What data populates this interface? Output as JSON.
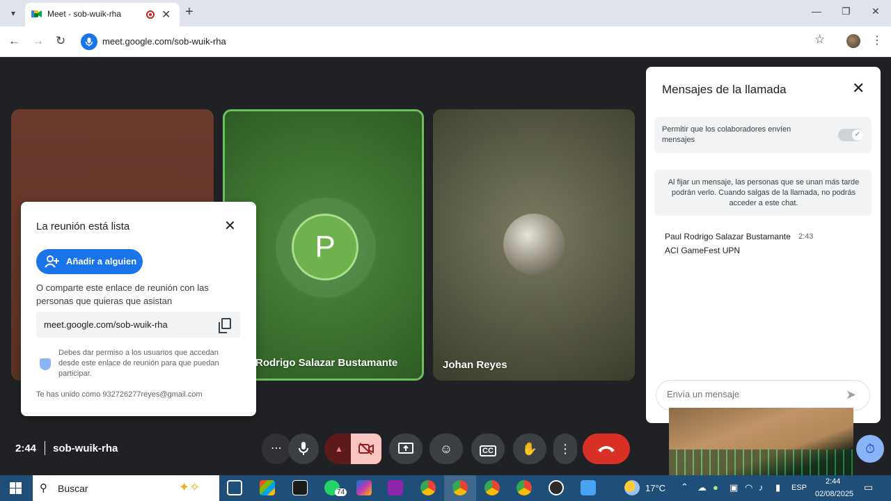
{
  "browser": {
    "tab_title": "Meet - sob-wuik-rha",
    "tab_close": "✕",
    "new_tab": "+",
    "window_controls": [
      "—",
      "❐",
      "✕"
    ],
    "url": "meet.google.com/sob-wuik-rha",
    "nav": {
      "back": "←",
      "forward": "→",
      "reload": "↻"
    },
    "star": "☆",
    "menu": "⋮"
  },
  "tiles": [
    {
      "name": ""
    },
    {
      "name": "Rodrigo Salazar Bustamante",
      "avatar_letter": "P"
    },
    {
      "name": "Johan Reyes"
    }
  ],
  "ready_card": {
    "title": "La reunión está lista",
    "close": "✕",
    "add_button": "Añadir a alguien",
    "share_text": "O comparte este enlace de reunión con las personas que quieras que asistan",
    "link": "meet.google.com/sob-wuik-rha",
    "permission_text": "Debes dar permiso a los usuarios que accedan desde este enlace de reunión para que puedan participar.",
    "joined_as": "Te has unido como 932726277reyes@gmail.com"
  },
  "chat": {
    "title": "Mensajes de la llamada",
    "close": "✕",
    "allow_text": "Permitir que los colaboradores envíen mensajes",
    "toggle_on": true,
    "pin_info": "Al fijar un mensaje, las personas que se unan más tarde podrán verlo. Cuando salgas de la llamada, no podrás acceder a este chat.",
    "messages": [
      {
        "sender": "Paul Rodrigo Salazar Bustamante",
        "time": "2:43",
        "text": "ACI GameFest UPN"
      }
    ],
    "compose_placeholder": "Envía un mensaje",
    "send": "➤"
  },
  "meeting_bar": {
    "time": "2:44",
    "code": "sob-wuik-rha"
  },
  "controls": {
    "more_left": "⋯",
    "mic": "🎙",
    "cam_toggle": "▲",
    "cam": "⊘",
    "present": "⬆",
    "emoji": "☺",
    "captions": "CC",
    "hand": "✋",
    "more": "⋮",
    "leave": "☎",
    "activities": "⏱"
  },
  "taskbar": {
    "search_placeholder": "Buscar",
    "whatsapp_badge": "74",
    "weather": "17°C",
    "language": "ESP",
    "time": "2:44",
    "date": "02/08/2025"
  },
  "colors": {
    "meet_blue": "#1a73e8",
    "leave_red": "#d93025",
    "speaking_green": "#6bc25a",
    "taskbar": "#1f4e79"
  }
}
